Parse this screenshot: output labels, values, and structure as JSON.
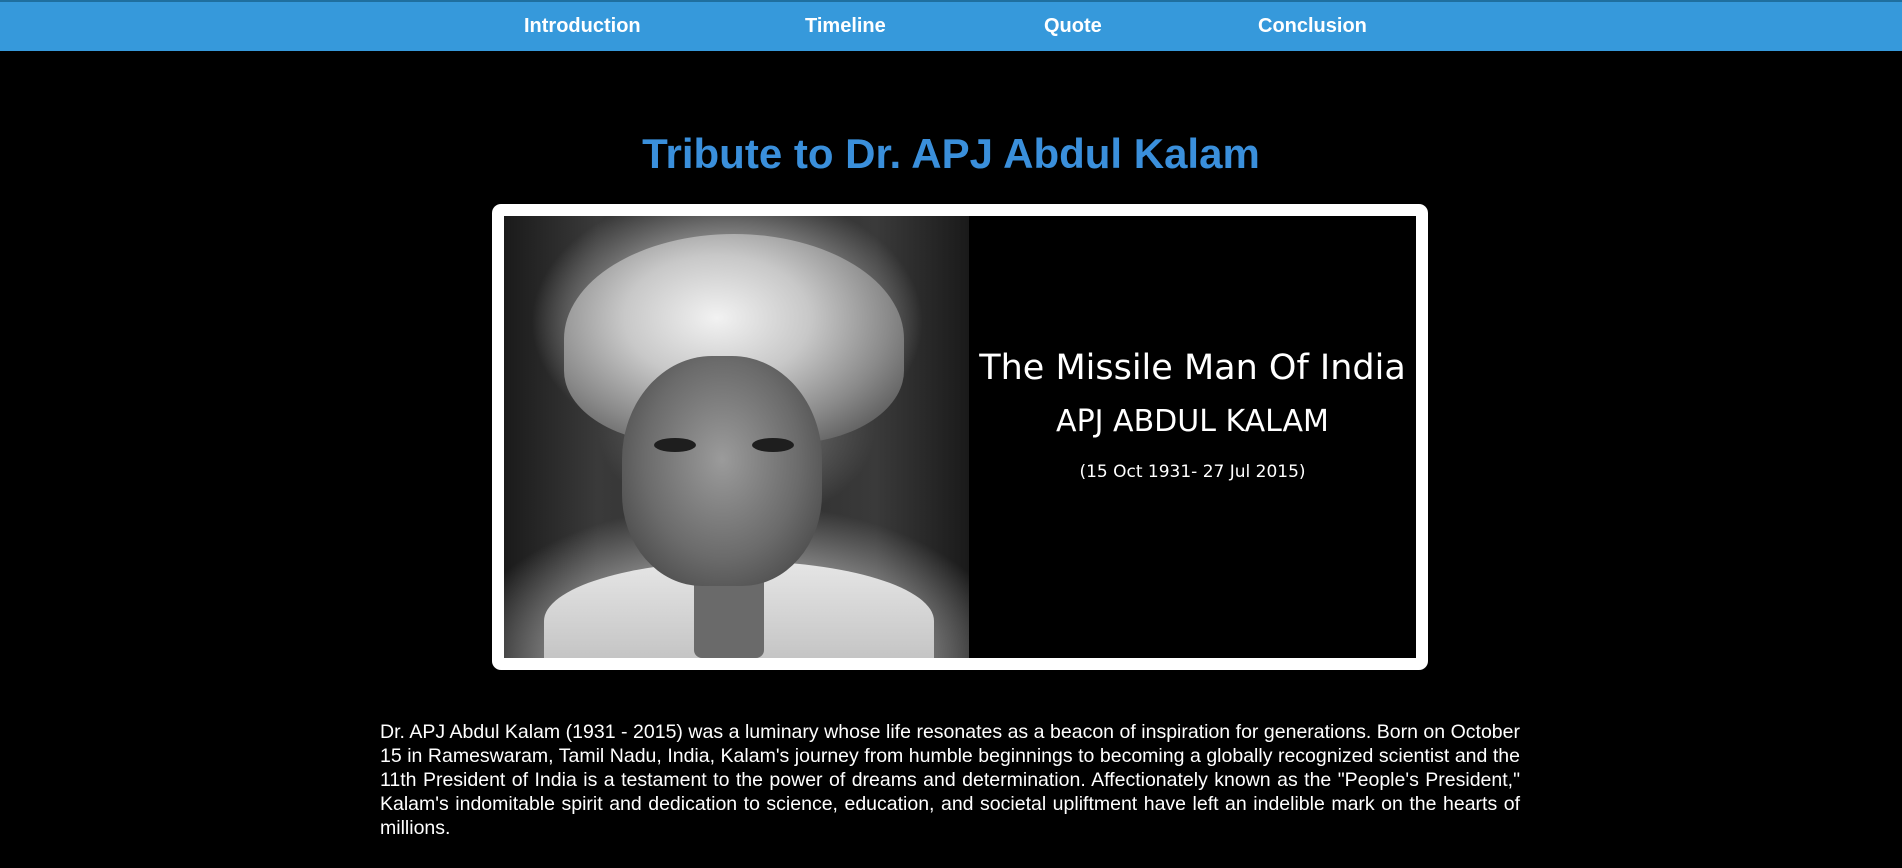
{
  "nav": {
    "items": [
      {
        "label": "Introduction"
      },
      {
        "label": "Timeline"
      },
      {
        "label": "Quote"
      },
      {
        "label": "Conclusion"
      }
    ],
    "background_color": "#3699db"
  },
  "header": {
    "title": "Tribute to Dr. APJ Abdul Kalam",
    "title_color": "#3a8fdb"
  },
  "hero_image": {
    "caption_title": "The Missile Man Of India",
    "caption_name": "APJ ABDUL KALAM",
    "caption_dates": "(15 Oct 1931- 27 Jul 2015)"
  },
  "intro": {
    "paragraph": "Dr. APJ Abdul Kalam (1931 - 2015) was a luminary whose life resonates as a beacon of inspiration for generations. Born on October 15 in Rameswaram, Tamil Nadu, India, Kalam's journey from humble beginnings to becoming a globally recognized scientist and the 11th President of India is a testament to the power of dreams and determination. Affectionately known as the \"People's President,\" Kalam's indomitable spirit and dedication to science, education, and societal upliftment have left an indelible mark on the hearts of millions."
  }
}
